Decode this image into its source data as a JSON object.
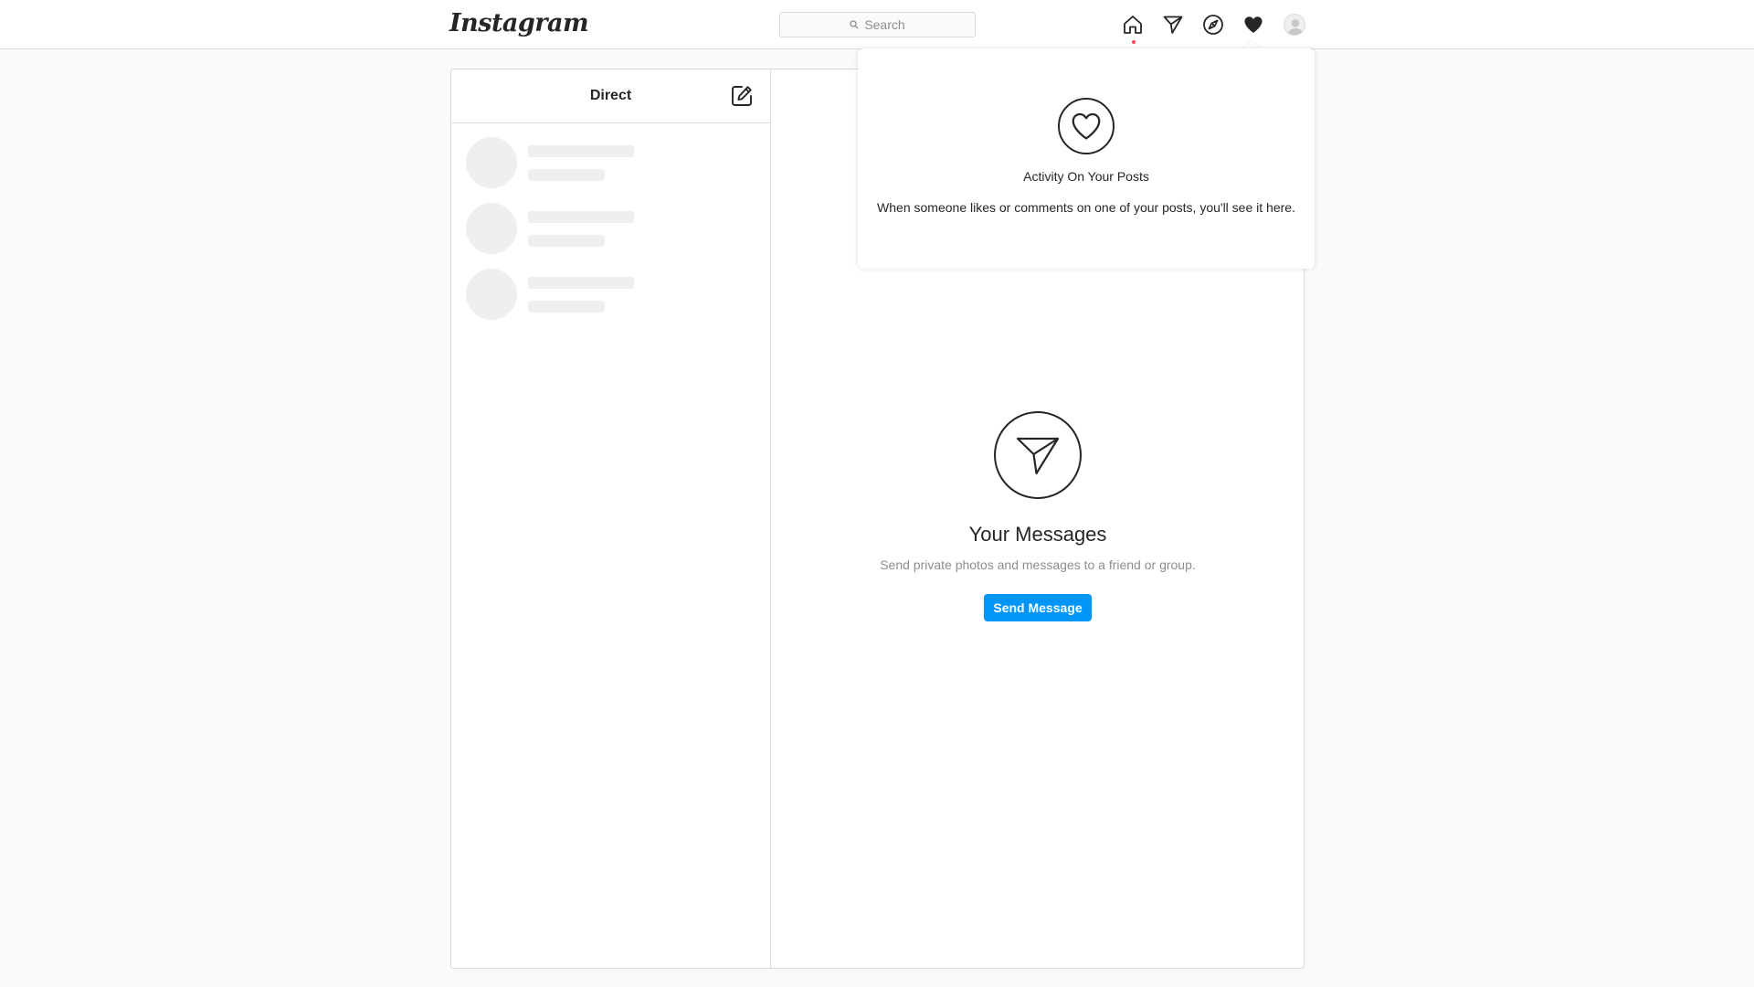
{
  "app": {
    "logo_text": "Instagram"
  },
  "search": {
    "placeholder": "Search"
  },
  "nav": {
    "icons": [
      "home-icon",
      "direct-icon",
      "explore-icon",
      "activity-heart-icon",
      "profile-avatar"
    ],
    "home_notification_color": "#ed4956"
  },
  "direct": {
    "title": "Direct",
    "compose_icon": "new-message-icon"
  },
  "empty_state": {
    "icon": "paper-plane-icon",
    "title": "Your Messages",
    "subtitle": "Send private photos and messages to a friend or group.",
    "button_label": "Send Message"
  },
  "activity_popover": {
    "icon": "heart-outline-icon",
    "title": "Activity On Your Posts",
    "message": "When someone likes or comments on one of your posts, you'll see it here."
  },
  "colors": {
    "accent": "#0095f6",
    "background": "#fafafa",
    "border": "#dbdbdb",
    "text": "#262626",
    "muted_text": "#8e8e8e",
    "skeleton": "#efefef"
  }
}
